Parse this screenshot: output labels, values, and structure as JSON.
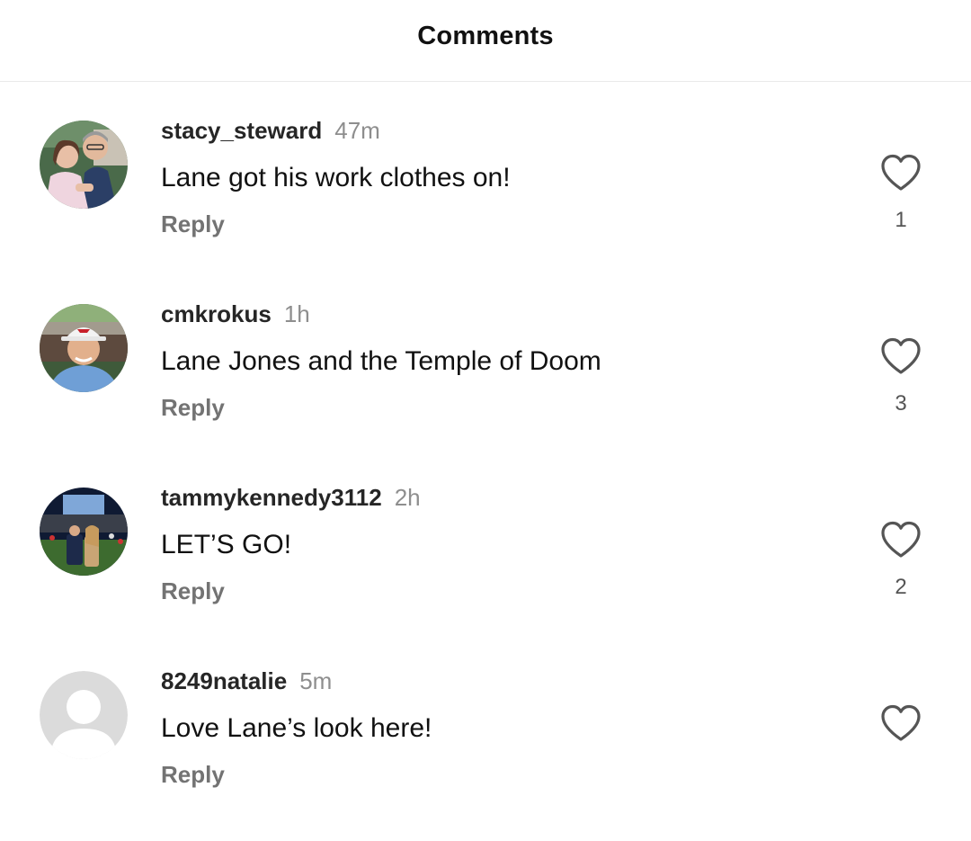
{
  "header": {
    "title": "Comments"
  },
  "comments": [
    {
      "username": "stacy_steward",
      "time": "47m",
      "text": "Lane got his work clothes on!",
      "reply_label": "Reply",
      "likes": "1",
      "avatar": "photo-couple"
    },
    {
      "username": "cmkrokus",
      "time": "1h",
      "text": "Lane Jones and the Temple of Doom",
      "reply_label": "Reply",
      "likes": "3",
      "avatar": "photo-man-cap"
    },
    {
      "username": "tammykennedy3112",
      "time": "2h",
      "text": "LET’S GO!",
      "reply_label": "Reply",
      "likes": "2",
      "avatar": "photo-stadium"
    },
    {
      "username": "8249natalie",
      "time": "5m",
      "text": "Love Lane’s look here!",
      "reply_label": "Reply",
      "likes": "",
      "avatar": "default-avatar"
    }
  ],
  "icons": {
    "like": "heart-outline-icon"
  },
  "colors": {
    "username": "#262626",
    "secondary_text": "#8e8e8e",
    "reply": "#737373",
    "divider": "#e9e9e9"
  }
}
